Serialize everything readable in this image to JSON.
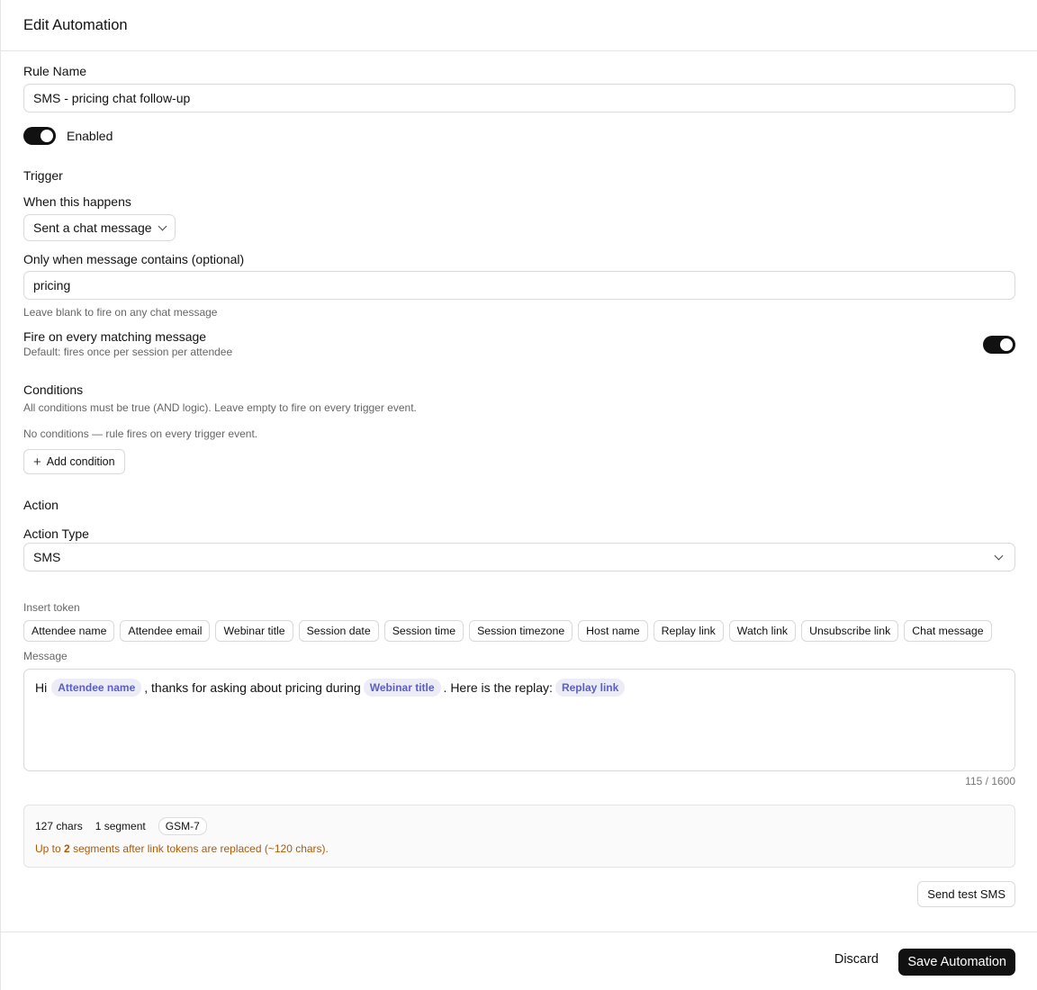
{
  "header": {
    "title": "Edit Automation"
  },
  "rule": {
    "name_label": "Rule Name",
    "name_value": "SMS - pricing chat follow-up",
    "enabled_label": "Enabled",
    "enabled": true
  },
  "trigger": {
    "section_title": "Trigger",
    "when_label": "When this happens",
    "event_value": "Sent a chat message",
    "contains_label": "Only when message contains (optional)",
    "contains_value": "pricing",
    "contains_help": "Leave blank to fire on any chat message",
    "fire_every_label": "Fire on every matching message",
    "fire_every_help": "Default: fires once per session per attendee",
    "fire_every_enabled": true
  },
  "conditions": {
    "section_title": "Conditions",
    "description": "All conditions must be true (AND logic). Leave empty to fire on every trigger event.",
    "empty_text": "No conditions — rule fires on every trigger event.",
    "add_label": "Add condition"
  },
  "action": {
    "section_title": "Action",
    "type_label": "Action Type",
    "type_value": "SMS",
    "insert_token_label": "Insert token",
    "tokens": [
      "Attendee name",
      "Attendee email",
      "Webinar title",
      "Session date",
      "Session time",
      "Session timezone",
      "Host name",
      "Replay link",
      "Watch link",
      "Unsubscribe link",
      "Chat message"
    ],
    "message_label": "Message",
    "message": {
      "t1": "Hi",
      "chip1": "Attendee name",
      "t2": ", thanks for asking about pricing during",
      "chip2": "Webinar title",
      "t3": ". Here is the replay:",
      "chip3": "Replay link"
    },
    "counter": "115 / 1600"
  },
  "sms_info": {
    "chars": "127 chars",
    "segments": "1 segment",
    "encoding": "GSM-7",
    "warn_prefix": "Up to",
    "warn_count": "2",
    "warn_suffix": "segments after link tokens are replaced (~120 chars)."
  },
  "buttons": {
    "send_test": "Send test SMS",
    "discard": "Discard",
    "save": "Save Automation"
  },
  "colors": {
    "primary": "#111111",
    "token_chip_bg": "#ececf7",
    "token_chip_text": "#5a5fc4",
    "warning_text": "#b05a08"
  }
}
